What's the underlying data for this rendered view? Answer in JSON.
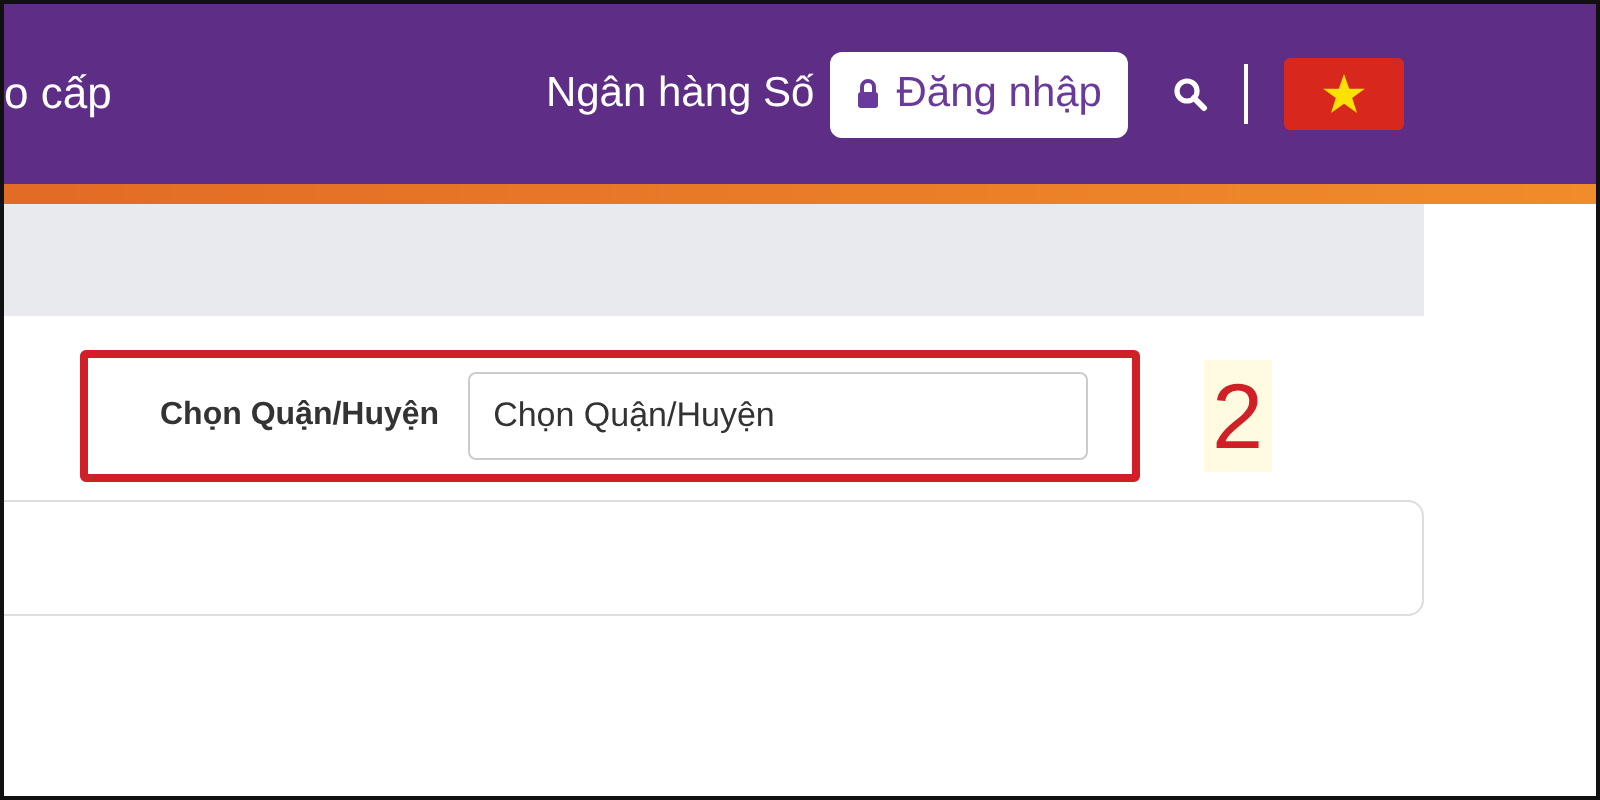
{
  "header": {
    "nav_item": "o cấp",
    "digital_bank": "Ngân hàng Số",
    "login_button": "Đăng nhập"
  },
  "district_filter": {
    "label": "Chọn Quận/Huyện",
    "field": {
      "value": "Chọn Quận/Huyện"
    },
    "highlighted": true
  },
  "step_marker": "2"
}
